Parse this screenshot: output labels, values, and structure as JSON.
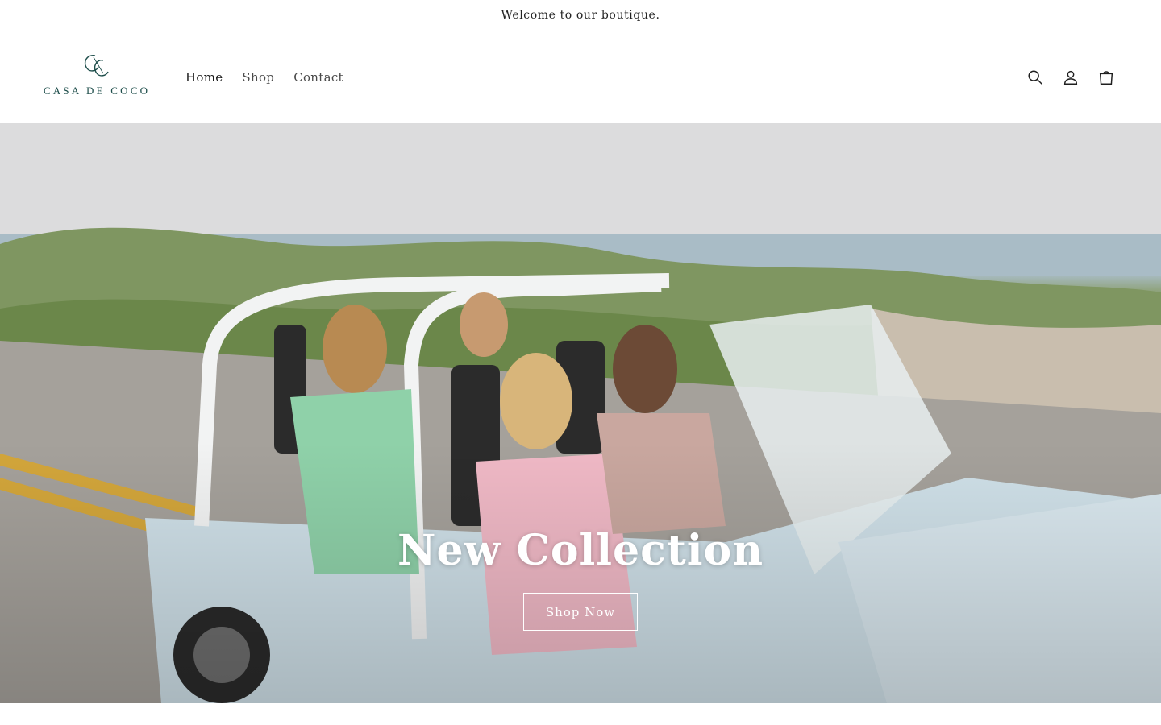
{
  "announcement": {
    "text": "Welcome to our boutique."
  },
  "header": {
    "logo_text": "CASA DE COCO",
    "nav": [
      {
        "label": "Home",
        "active": true
      },
      {
        "label": "Shop",
        "active": false
      },
      {
        "label": "Contact",
        "active": false
      }
    ],
    "icons": [
      "search-icon",
      "account-icon",
      "cart-icon"
    ]
  },
  "hero": {
    "title": "New Collection",
    "button_label": "Shop Now",
    "image_description": ""
  },
  "colors": {
    "brand_teal": "#1d4d4a",
    "text": "#1f1f1f",
    "hero_text": "#ffffff"
  }
}
